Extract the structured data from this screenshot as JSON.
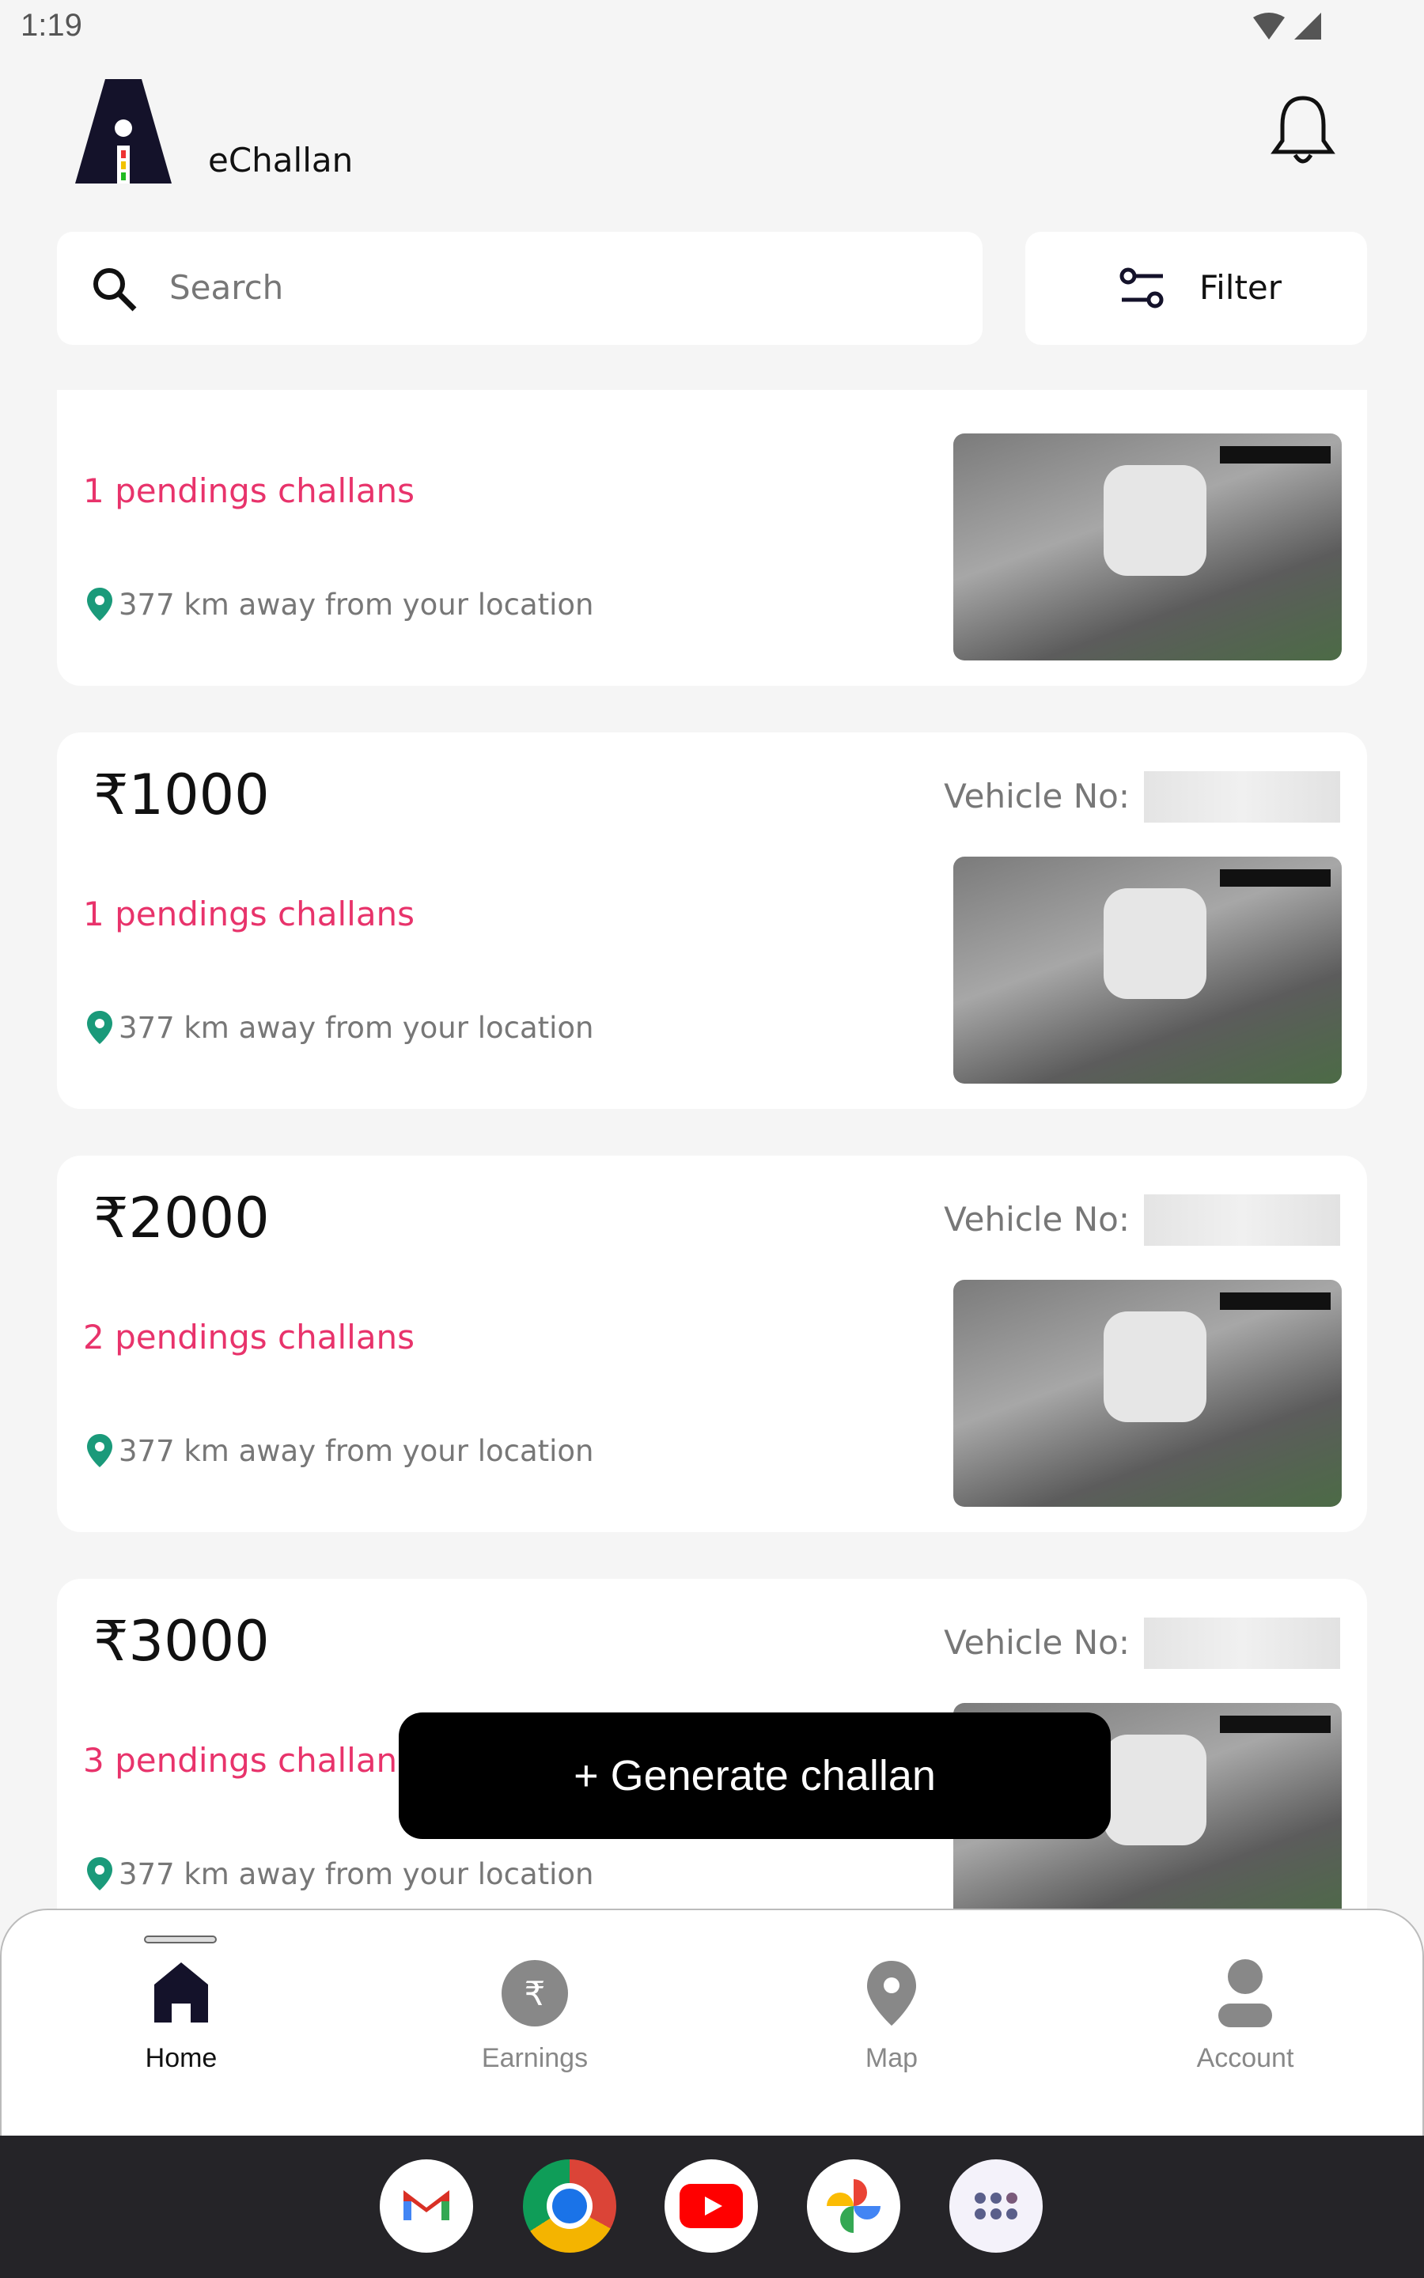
{
  "status_bar": {
    "time": "1:19",
    "icons": [
      "wifi-icon",
      "signal-icon"
    ]
  },
  "header": {
    "title": "eChallan",
    "logo": "traffic-light-logo",
    "bell_icon": "bell-icon"
  },
  "search": {
    "placeholder": "Search",
    "value": ""
  },
  "filter": {
    "label": "Filter"
  },
  "cards": [
    {
      "amount": "",
      "vehicle_label": "",
      "pending": "1 pendings challans",
      "distance": "377 km away from your location"
    },
    {
      "amount": "₹1000",
      "vehicle_label": "Vehicle No:",
      "pending": "1 pendings challans",
      "distance": "377 km away from your location"
    },
    {
      "amount": "₹2000",
      "vehicle_label": "Vehicle No:",
      "pending": "2 pendings challans",
      "distance": "377 km away from your location"
    },
    {
      "amount": "₹3000",
      "vehicle_label": "Vehicle No:",
      "pending": "3 pendings challans",
      "distance": "377 km away from your location"
    }
  ],
  "generate_button": "+ Generate challan",
  "nav": [
    {
      "label": "Home",
      "icon": "home-icon",
      "active": true
    },
    {
      "label": "Earnings",
      "icon": "rupee-icon",
      "active": false
    },
    {
      "label": "Map",
      "icon": "map-pin-icon",
      "active": false
    },
    {
      "label": "Account",
      "icon": "account-icon",
      "active": false
    }
  ],
  "dock": [
    "gmail-icon",
    "chrome-icon",
    "youtube-icon",
    "photos-icon",
    "app-drawer-icon"
  ],
  "colors": {
    "accent_pink": "#e8336b",
    "pin_green": "#1a9a7a",
    "active_nav": "#14122a",
    "inactive_nav": "#888888",
    "dock_bg": "#252428"
  }
}
